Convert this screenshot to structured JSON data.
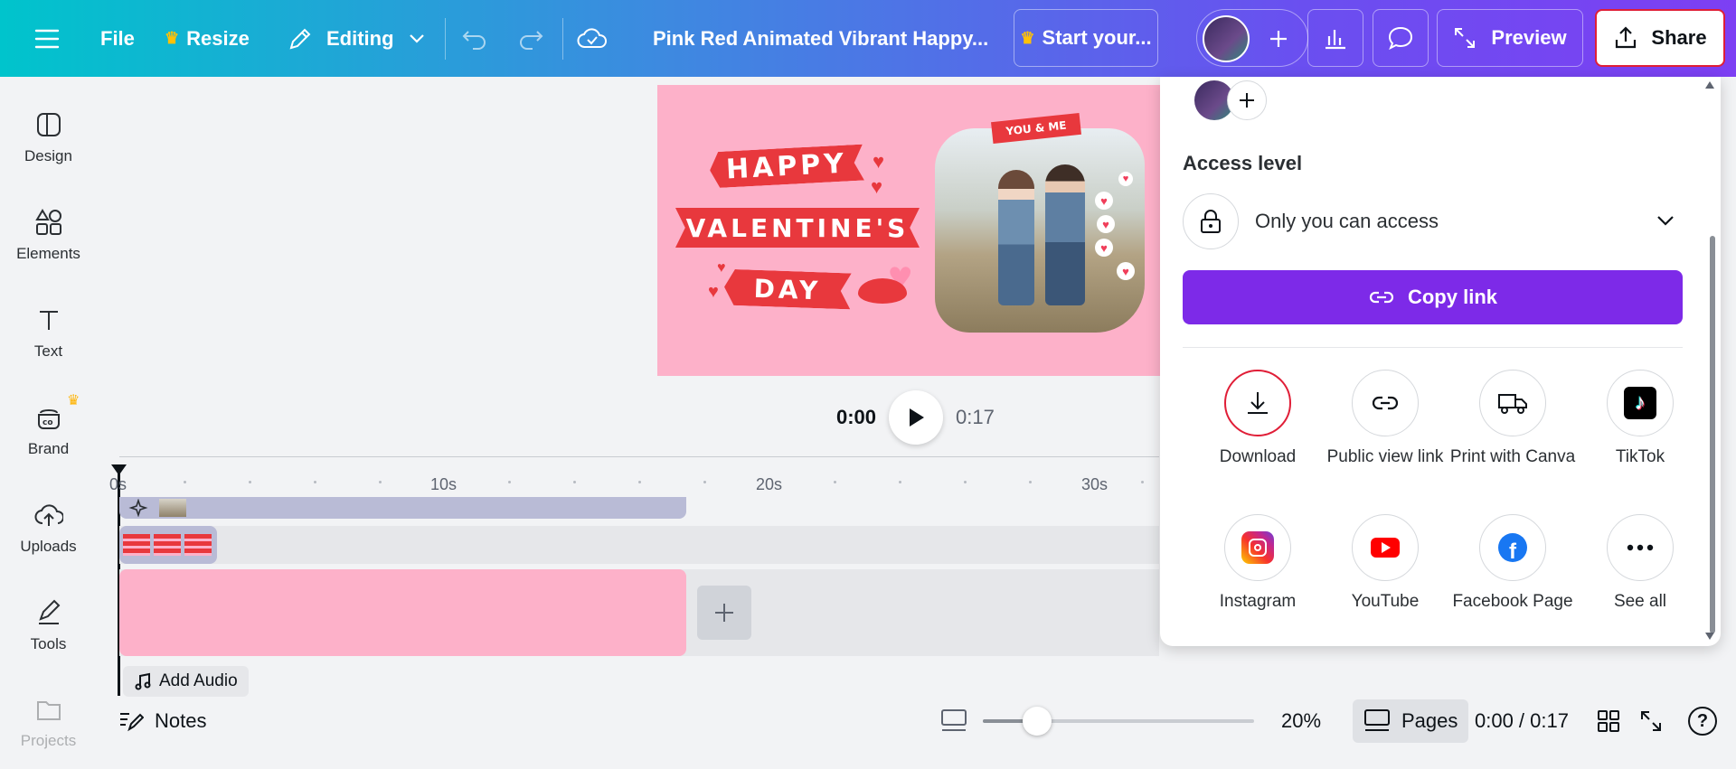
{
  "topbar": {
    "file": "File",
    "resize": "Resize",
    "editing": "Editing",
    "title": "Pink Red Animated Vibrant Happy...",
    "start": "Start your...",
    "preview": "Preview",
    "share": "Share"
  },
  "sidebar": {
    "items": [
      {
        "label": "Design"
      },
      {
        "label": "Elements"
      },
      {
        "label": "Text"
      },
      {
        "label": "Brand"
      },
      {
        "label": "Uploads"
      },
      {
        "label": "Tools"
      },
      {
        "label": "Projects"
      }
    ]
  },
  "canvas": {
    "line1": "HAPPY",
    "line2": "VALENTINE'S",
    "line3": "DAY",
    "tag": "YOU & ME"
  },
  "playback": {
    "current": "0:00",
    "total": "0:17"
  },
  "timeline": {
    "ticks": [
      "0s",
      "10s",
      "20s",
      "30s"
    ],
    "add_audio": "Add Audio"
  },
  "share_panel": {
    "access_label": "Access level",
    "access_value": "Only you can access",
    "copy_link": "Copy link",
    "options": [
      {
        "label": "Download"
      },
      {
        "label": "Public view link"
      },
      {
        "label": "Print with Canva"
      },
      {
        "label": "TikTok"
      },
      {
        "label": "Instagram"
      },
      {
        "label": "YouTube"
      },
      {
        "label": "Facebook Page"
      },
      {
        "label": "See all"
      }
    ]
  },
  "bottombar": {
    "notes": "Notes",
    "zoom": "20%",
    "zoom_level": 0.2,
    "pages": "Pages",
    "time": "0:00 / 0:17"
  },
  "colors": {
    "accent": "#7d2ae8",
    "download_ring": "#e01e37",
    "canvas_bg": "#fdb1c9",
    "ribbon": "#e8383d"
  }
}
